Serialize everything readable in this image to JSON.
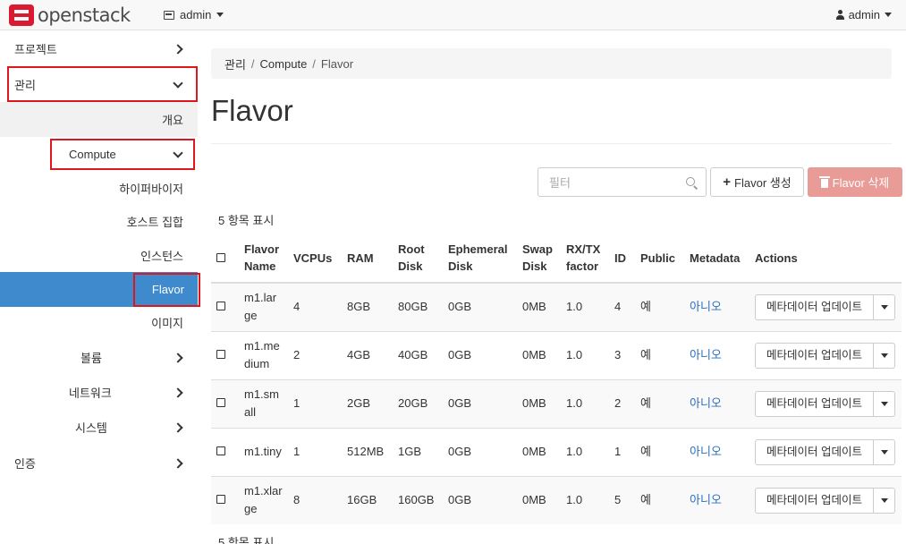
{
  "topbar": {
    "brand": "openstack",
    "project": "admin",
    "user": "admin"
  },
  "sidebar": {
    "project": "프로젝트",
    "admin": "관리",
    "overview": "개요",
    "compute": "Compute",
    "hypervisors": "하이퍼바이저",
    "host_aggregates": "호스트 집합",
    "instances": "인스턴스",
    "flavors": "Flavor",
    "images": "이미지",
    "volumes": "볼륨",
    "network": "네트워크",
    "system": "시스템",
    "identity": "인증"
  },
  "breadcrumb": [
    "관리",
    "Compute",
    "Flavor"
  ],
  "page_title": "Flavor",
  "toolbar": {
    "filter_placeholder": "필터",
    "create_label": "Flavor 생성",
    "delete_label": "Flavor 삭제"
  },
  "count_text": "5 항목 표시",
  "table": {
    "headers": [
      "Flavor Name",
      "VCPUs",
      "RAM",
      "Root Disk",
      "Ephemeral Disk",
      "Swap Disk",
      "RX/TX factor",
      "ID",
      "Public",
      "Metadata",
      "Actions"
    ],
    "rows": [
      {
        "name": "m1.large",
        "vcpus": "4",
        "ram": "8GB",
        "root": "80GB",
        "eph": "0GB",
        "swap": "0MB",
        "rxtx": "1.0",
        "id": "4",
        "public": "예",
        "metadata": "아니오",
        "action": "메타데이터 업데이트"
      },
      {
        "name": "m1.medium",
        "vcpus": "2",
        "ram": "4GB",
        "root": "40GB",
        "eph": "0GB",
        "swap": "0MB",
        "rxtx": "1.0",
        "id": "3",
        "public": "예",
        "metadata": "아니오",
        "action": "메타데이터 업데이트"
      },
      {
        "name": "m1.small",
        "vcpus": "1",
        "ram": "2GB",
        "root": "20GB",
        "eph": "0GB",
        "swap": "0MB",
        "rxtx": "1.0",
        "id": "2",
        "public": "예",
        "metadata": "아니오",
        "action": "메타데이터 업데이트"
      },
      {
        "name": "m1.tiny",
        "vcpus": "1",
        "ram": "512MB",
        "root": "1GB",
        "eph": "0GB",
        "swap": "0MB",
        "rxtx": "1.0",
        "id": "1",
        "public": "예",
        "metadata": "아니오",
        "action": "메타데이터 업데이트"
      },
      {
        "name": "m1.xlarge",
        "vcpus": "8",
        "ram": "16GB",
        "root": "160GB",
        "eph": "0GB",
        "swap": "0MB",
        "rxtx": "1.0",
        "id": "5",
        "public": "예",
        "metadata": "아니오",
        "action": "메타데이터 업데이트"
      }
    ]
  },
  "colors": {
    "active_nav": "#3e8acc",
    "highlight": "#e0161d",
    "danger_disabled": "#e99b98",
    "link": "#2a6ebb"
  }
}
